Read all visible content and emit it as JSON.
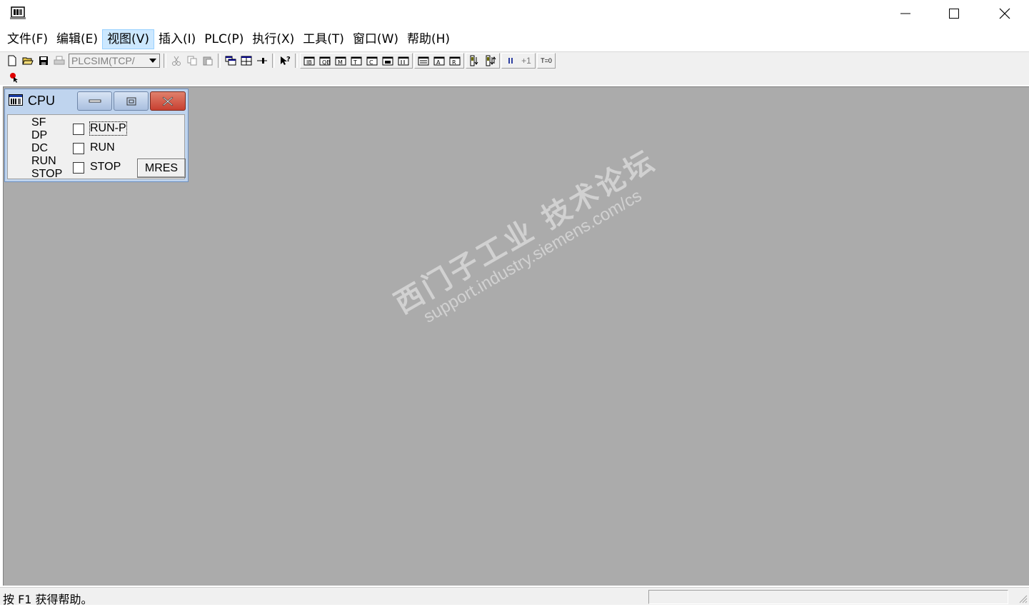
{
  "menu": {
    "items": [
      {
        "label": "文件(F)"
      },
      {
        "label": "编辑(E)"
      },
      {
        "label": "视图(V)"
      },
      {
        "label": "插入(I)"
      },
      {
        "label": "PLC(P)"
      },
      {
        "label": "执行(X)"
      },
      {
        "label": "工具(T)"
      },
      {
        "label": "窗口(W)"
      },
      {
        "label": "帮助(H)"
      }
    ]
  },
  "toolbar": {
    "connection_value": "PLCSIM(TCP/",
    "step_label": "+1",
    "timer_label": "T=0"
  },
  "cpu_window": {
    "title": "CPU",
    "leds": [
      "SF",
      "DP",
      "DC",
      "RUN",
      "STOP"
    ],
    "modes": [
      {
        "label": "RUN-P",
        "checked": false
      },
      {
        "label": "RUN",
        "checked": false
      },
      {
        "label": "STOP",
        "checked": false
      }
    ],
    "mres_label": "MRES"
  },
  "watermark": {
    "line1": "西门子工业 技术论坛",
    "line2": "support.industry.siemens.com/cs"
  },
  "status": {
    "text": "按 F1 获得帮助。"
  },
  "colors": {
    "mdi_background": "#ababab",
    "cpu_title": "#bfd4ee",
    "close_button": "#c84031"
  }
}
